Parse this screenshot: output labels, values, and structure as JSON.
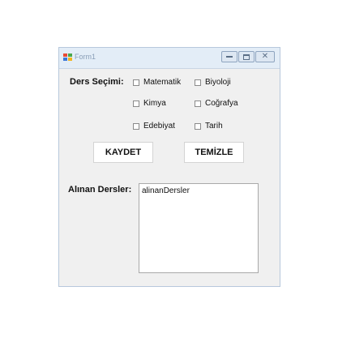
{
  "window": {
    "title": "Form1",
    "minimize_label": "",
    "maximize_label": "",
    "close_label": "✕"
  },
  "form": {
    "ders_secimi_label": "Ders Seçimi:",
    "checkboxes": [
      {
        "label": "Matematik",
        "checked": false
      },
      {
        "label": "Biyoloji",
        "checked": false
      },
      {
        "label": "Kimya",
        "checked": false
      },
      {
        "label": "Coğrafya",
        "checked": false
      },
      {
        "label": "Edebiyat",
        "checked": false
      },
      {
        "label": "Tarih",
        "checked": false
      }
    ],
    "kaydet_button": "KAYDET",
    "temizle_button": "TEMİZLE",
    "alinan_dersler_label": "Alınan Dersler:",
    "listbox_items": [
      "alinanDersler"
    ]
  },
  "colors": {
    "form_background": "#f0f0f0",
    "titlebar_background": "#e3edf7",
    "window_border": "#b7c8dc"
  }
}
